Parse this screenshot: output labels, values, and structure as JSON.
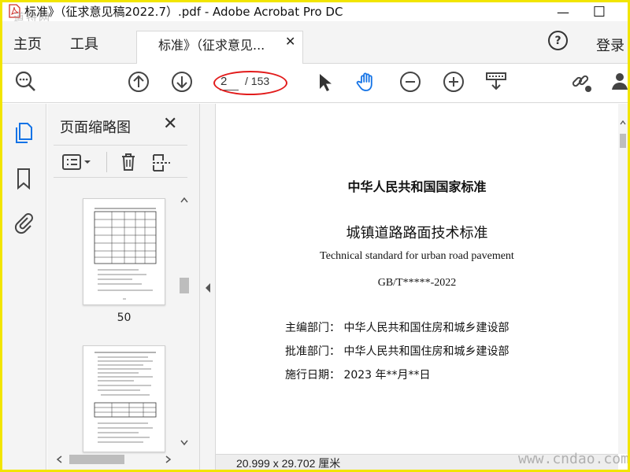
{
  "window": {
    "title": "标准》（征求意见稿2022.7）.pdf - Adobe Acrobat Pro DC",
    "minimize": "—",
    "maximize": "☐",
    "watermark_top": "道特网"
  },
  "menubar": {
    "home": "主页",
    "tools": "工具",
    "tab_title": "标准》（征求意见...",
    "tab_close": "✕",
    "help": "?",
    "login": "登录"
  },
  "toolbar": {
    "current_page": "2",
    "total_pages": "/ 153",
    "icons": [
      "search-icon",
      "page-up-icon",
      "page-down-icon",
      "select-cursor-icon",
      "hand-tool-icon",
      "zoom-out-icon",
      "zoom-in-icon",
      "fit-page-icon",
      "share-link-icon",
      "account-icon"
    ]
  },
  "thumbnails": {
    "title": "页面缩略图",
    "close": "✕",
    "items": [
      {
        "label": "50"
      },
      {
        "label": ""
      }
    ]
  },
  "document": {
    "heading": "中华人民共和国国家标准",
    "title_cn": "城镇道路路面技术标准",
    "title_en": "Technical  standard  for urban road pavement",
    "code": "GB/T*****-2022",
    "lines": [
      "主编部门：  中华人民共和国住房和城乡建设部",
      "批准部门：  中华人民共和国住房和城乡建设部",
      "施行日期：  2023 年**月**日"
    ]
  },
  "status": {
    "page_size": "20.999 x 29.702 厘米",
    "watermark_bottom": "www.cndao.com"
  },
  "colors": {
    "frame": "#f2e500",
    "accent_blue": "#1473e6",
    "annotation_red": "#e21b1b"
  }
}
